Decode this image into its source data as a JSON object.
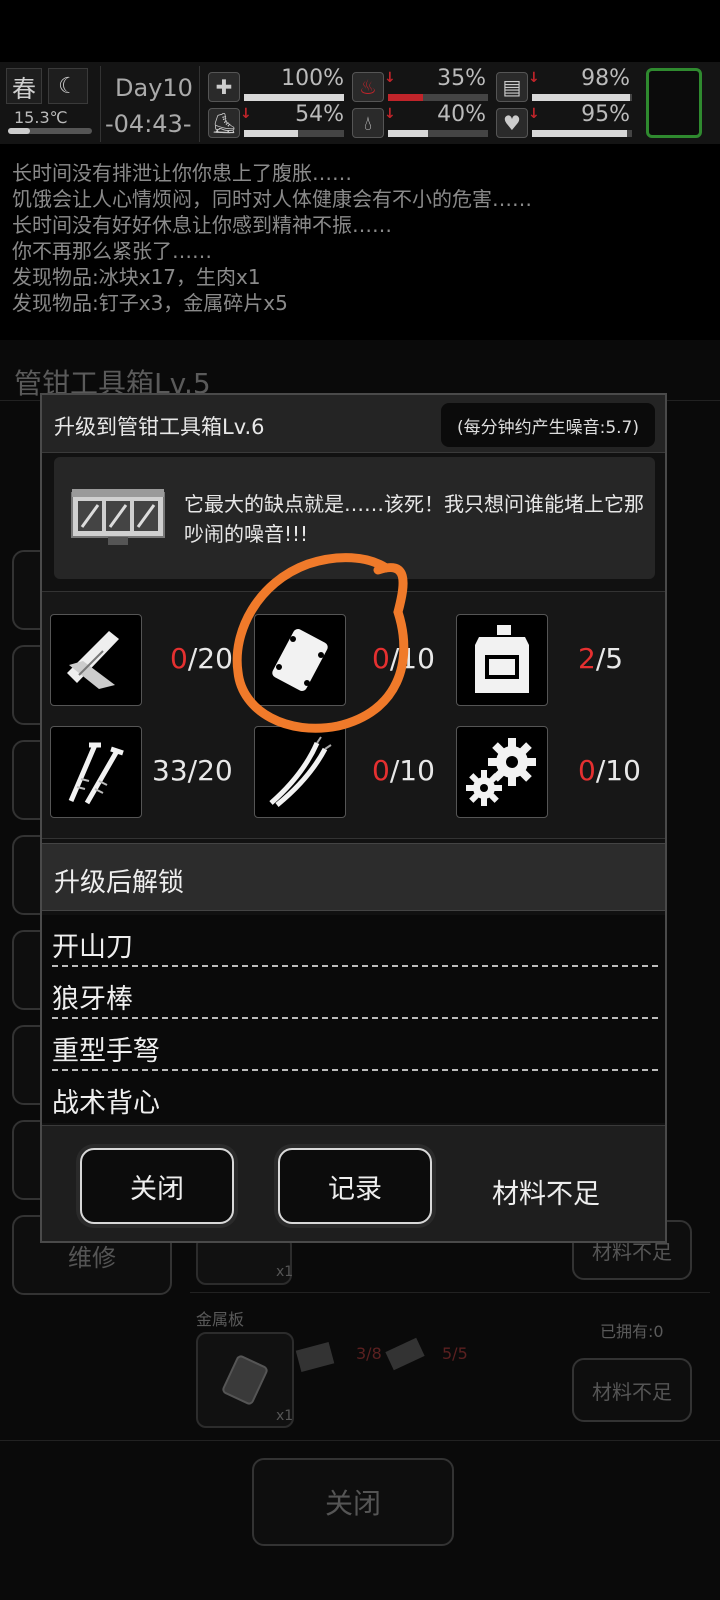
{
  "status": {
    "season": "春",
    "moon_icon": "moon-icon",
    "temperature": "15.3℃",
    "day": "Day10",
    "time": "-04:43-",
    "stats": [
      {
        "name": "health",
        "icon": "first-aid-icon",
        "value": "100%",
        "level": 1.0,
        "alert": false
      },
      {
        "name": "stomach",
        "icon": "stomach-icon",
        "value": "35%",
        "level": 0.35,
        "alert": true
      },
      {
        "name": "food",
        "icon": "food-can-icon",
        "value": "98%",
        "level": 0.98,
        "alert": true
      },
      {
        "name": "stamina",
        "icon": "boot-icon",
        "value": "54%",
        "level": 0.54,
        "alert": true
      },
      {
        "name": "water",
        "icon": "water-drop-icon",
        "value": "40%",
        "level": 0.4,
        "alert": true
      },
      {
        "name": "mood",
        "icon": "heart-icon",
        "value": "95%",
        "level": 0.95,
        "alert": true
      }
    ]
  },
  "log": [
    "长时间没有排泄让你你患上了腹胀……",
    "饥饿会让人心情烦闷，同时对人体健康会有不小的危害……",
    "长时间没有好好休息让你感到精神不振……",
    "你不再那么紧张了……",
    "发现物品:冰块x17，生肉x1",
    "发现物品:钉子x3，金属碎片x5"
  ],
  "background": {
    "title": "管钳工具箱Lv.5",
    "repair_button": "维修",
    "close_button": "关闭",
    "item_x1": "x1",
    "item2_name": "金属板",
    "item2_owned": "已拥有:0",
    "item2_req1": "3/8",
    "item2_req2": "5/5",
    "insufficient": "材料不足"
  },
  "modal": {
    "title": "升级到管钳工具箱Lv.6",
    "noise": "(每分钟约产生噪音:5.7)",
    "description": "它最大的缺点就是……该死！我只想问谁能堵上它那吵闹的噪音!!!",
    "materials": [
      {
        "icon": "wood-planks-icon",
        "have": "0",
        "need": "/20",
        "enough": false
      },
      {
        "icon": "metal-plate-icon",
        "have": "0",
        "need": "/10",
        "enough": false
      },
      {
        "icon": "fuel-can-icon",
        "have": "2",
        "need": "/5",
        "enough": false
      },
      {
        "icon": "nails-icon",
        "have": "33",
        "need": "/20",
        "enough": true
      },
      {
        "icon": "wires-icon",
        "have": "0",
        "need": "/10",
        "enough": false
      },
      {
        "icon": "gears-icon",
        "have": "0",
        "need": "/10",
        "enough": false
      }
    ],
    "unlock_header": "升级后解锁",
    "unlocks": [
      "开山刀",
      "狼牙棒",
      "重型手弩",
      "战术背心"
    ],
    "close_button": "关闭",
    "record_button": "记录",
    "status_text": "材料不足"
  },
  "colors": {
    "accent_red": "#e53030",
    "annotation_orange": "#f07a2a",
    "slot_green": "#2f8a2f"
  }
}
